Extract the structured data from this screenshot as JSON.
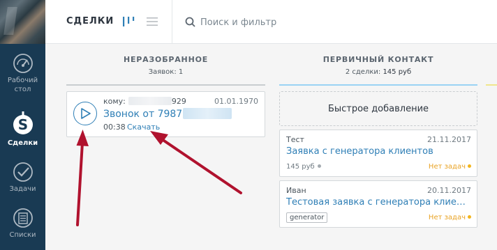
{
  "sidebar": {
    "items": [
      {
        "label": "Рабочий стол",
        "icon": "dashboard-speedometer-icon"
      },
      {
        "label": "Сделки",
        "icon": "dollar-icon",
        "active": true
      },
      {
        "label": "Задачи",
        "icon": "checkmark-circle-icon"
      },
      {
        "label": "Списки",
        "icon": "list-document-icon"
      }
    ]
  },
  "header": {
    "title": "СДЕЛКИ",
    "search_placeholder": "Поиск и фильтр"
  },
  "columns": [
    {
      "title": "НЕРАЗОБРАННОЕ",
      "subtitle": "Заявок: 1"
    },
    {
      "title": "ПЕРВИЧНЫЙ КОНТАКТ",
      "subtitle_prefix": "2 сделки:",
      "subtitle_value": "145 руб"
    }
  ],
  "call_card": {
    "to_prefix": "кому:",
    "to_number_visible": "929",
    "date": "01.01.1970",
    "title_prefix": "Звонок от 7987",
    "duration": "00:38",
    "download_label": "Скачать"
  },
  "quick_add_label": "Быстрое добавление",
  "leads": [
    {
      "contact": "Тест",
      "date": "21.11.2017",
      "title": "Заявка с генератора клиентов",
      "price": "145 руб",
      "tasks": "Нет задач"
    },
    {
      "contact": "Иван",
      "date": "20.11.2017",
      "title": "Тестовая заявка с генератора клиенто...",
      "tag": "generator",
      "tasks": "Нет задач"
    }
  ],
  "colors": {
    "sidebar_bg": "#193a53",
    "link": "#2f7fb6",
    "no_tasks": "#e9a324",
    "arrow": "#b0122e"
  }
}
